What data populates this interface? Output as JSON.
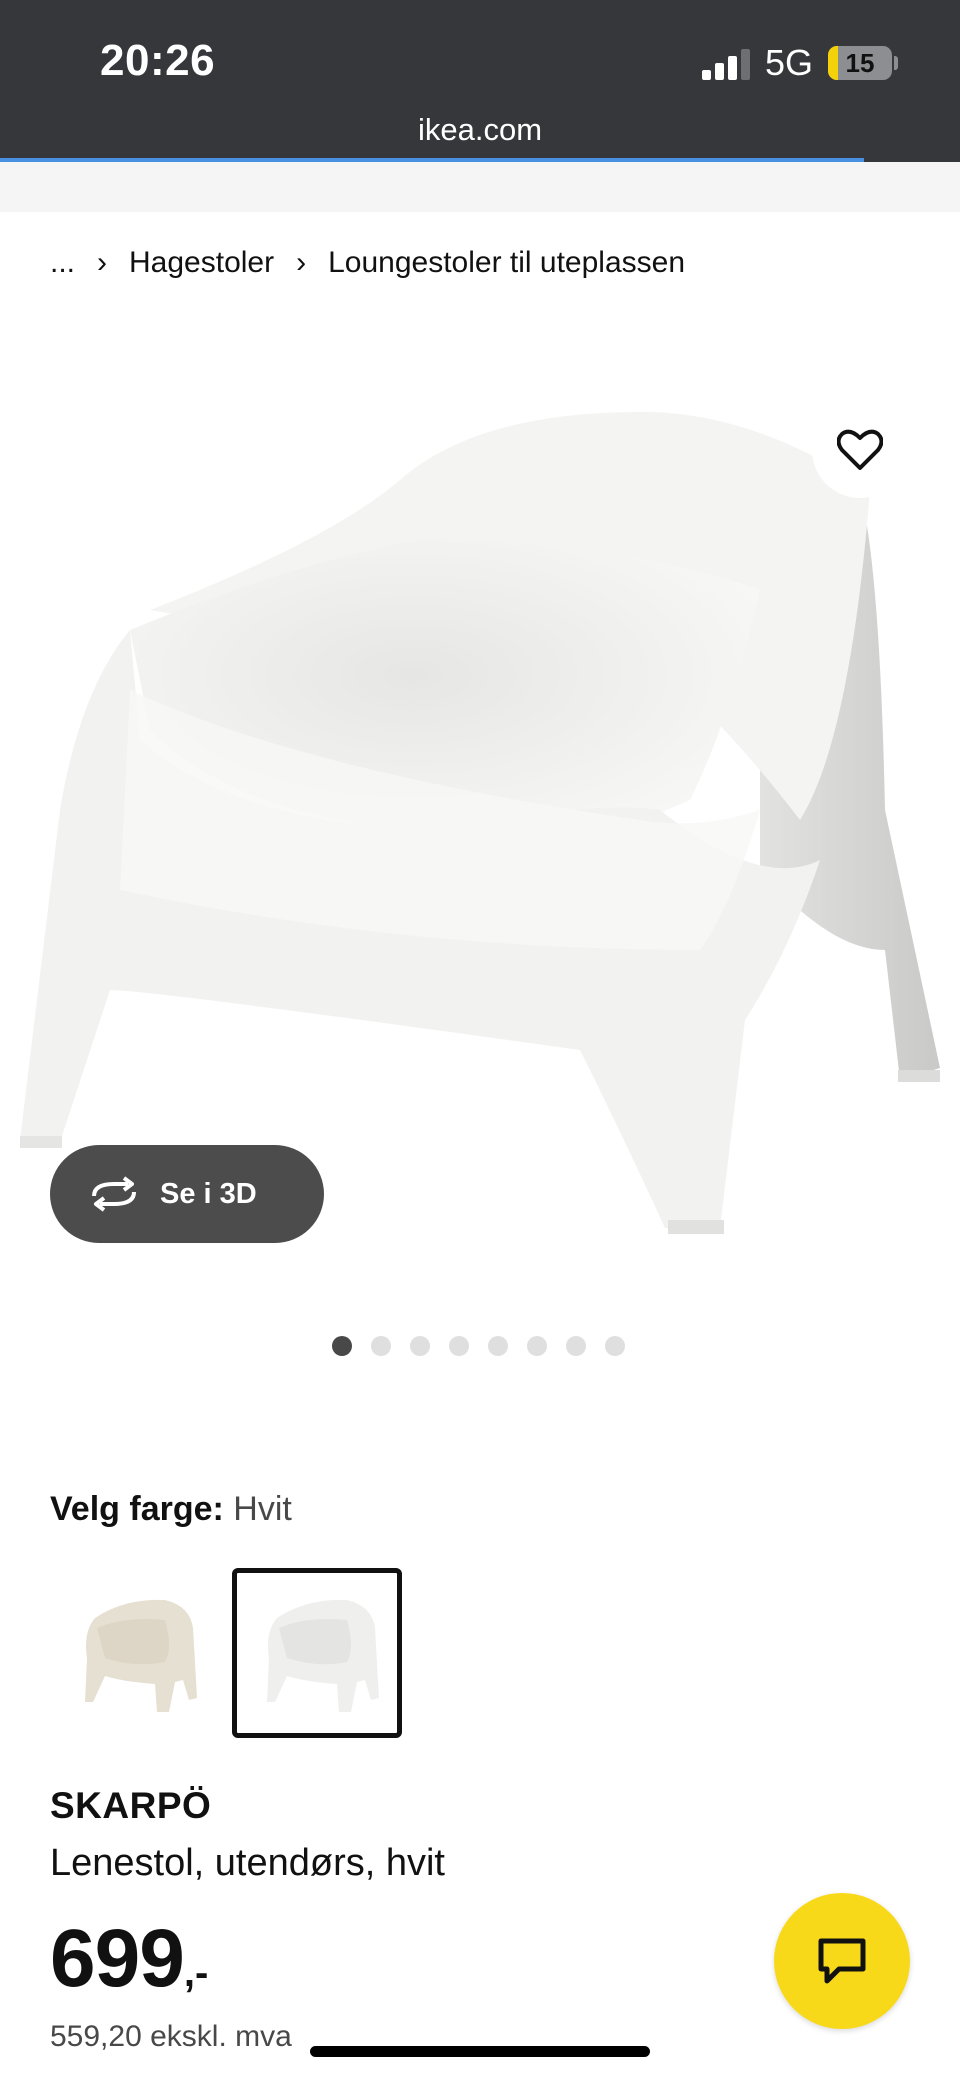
{
  "status_bar": {
    "time": "20:26",
    "network": "5G",
    "battery": "15",
    "battery_level": 0.15,
    "signal_bars_active": 3
  },
  "browser": {
    "url": "ikea.com",
    "load_progress": 0.9
  },
  "breadcrumb": {
    "ellipsis": "...",
    "items": [
      "Hagestoler",
      "Loungestoler til uteplassen"
    ]
  },
  "gallery": {
    "view_3d_label": "Se i 3D",
    "icons": [
      "heart-icon",
      "rotate-3d-icon"
    ],
    "image_count": 8,
    "active_index": 0
  },
  "color_picker": {
    "label": "Velg farge:",
    "selected_value": "Hvit",
    "options": [
      {
        "name": "beige",
        "color": "#e6e0d2",
        "selected": false
      },
      {
        "name": "white",
        "color": "#f1f1ef",
        "selected": true
      }
    ]
  },
  "product": {
    "name": "SKARPÖ",
    "description": "Lenestol, utendørs, hvit",
    "price": "699",
    "price_suffix": ",-",
    "price_ex_vat": "559,20 ekskl. mva"
  },
  "chat_button": {
    "icon": "chat-bubble-icon",
    "color": "#f8d919"
  }
}
